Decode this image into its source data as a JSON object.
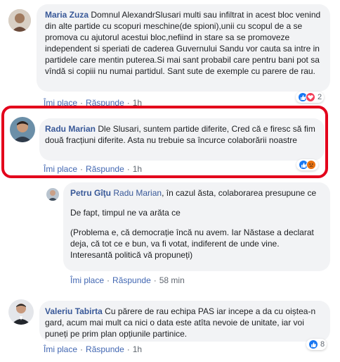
{
  "comments": [
    {
      "author": "Maria Zuza",
      "text": "Domnul AlexandrSlusari multi sau infiltrat in acest bloc venind din alte partide cu scopuri meschine(de spioni),unii cu scopul de a se promova cu ajutorul acestui bloc,nefiind in stare sa se promoveze independent si speriati de caderea Guvernului Sandu vor cauta sa intre in partidele care mentin puterea.Si mai sant probabil care pentru bani pot sa vîndă si copiii nu numai partidul. Sant sute de exemple cu parere de rau.",
      "like": "Îmi place",
      "reply": "Răspunde",
      "time": "1h",
      "reaction_count": "2"
    },
    {
      "author": "Radu Marian",
      "text": "Dle Slusari, suntem partide diferite, Cred că e firesc să fim două fracțiuni diferite. Asta nu trebuie sa încurce colaborării noastre",
      "like": "Îmi place",
      "reply": "Răspunde",
      "time": "1h"
    },
    {
      "author": "Petru Gîţu",
      "mention": "Radu Marian",
      "text": ", în cazul ăsta, colaborarea presupune ce",
      "para2": "De fapt, timpul ne va arăta ce",
      "para3": "(Problema e, că democrație încă nu avem. Iar Năstase a declarat deja, că tot ce e bun, va fi votat, indiferent de unde vine. Interesantă politică vă propuneți)",
      "like": "Îmi place",
      "reply": "Răspunde",
      "time": "58 min"
    },
    {
      "author": "Valeriu Tabirta",
      "text": "Cu părere de rau echipa PAS iar incepe a da cu oiștea-n gard, acum mai mult ca nici o data este atîta nevoie de unitate, iar voi puneți pe prim plan opțiunile partinice.",
      "like": "Îmi place",
      "reply": "Răspunde",
      "time": "1h",
      "reaction_count": "8"
    }
  ],
  "colors": {
    "author": "#385898",
    "link": "#4267b2",
    "bubble": "#f2f3f5",
    "highlight": "#e3001b"
  },
  "icons": [
    "like-reaction-icon",
    "love-reaction-icon",
    "angry-reaction-icon",
    "avatar"
  ]
}
